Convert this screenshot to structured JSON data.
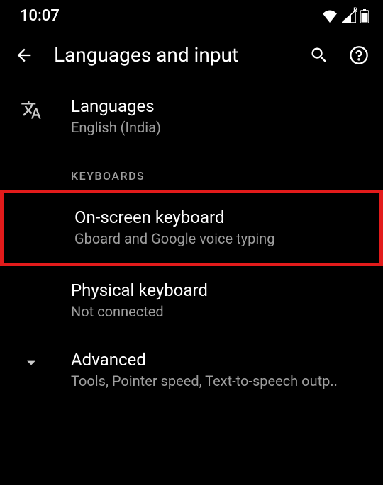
{
  "status": {
    "time": "10:07"
  },
  "header": {
    "title": "Languages and input"
  },
  "languages": {
    "title": "Languages",
    "subtitle": "English (India)"
  },
  "sections": {
    "keyboards_header": "KEYBOARDS"
  },
  "onscreen": {
    "title": "On-screen keyboard",
    "subtitle": "Gboard and Google voice typing"
  },
  "physical": {
    "title": "Physical keyboard",
    "subtitle": "Not connected"
  },
  "advanced": {
    "title": "Advanced",
    "subtitle": "Tools, Pointer speed, Text-to-speech outp.."
  }
}
